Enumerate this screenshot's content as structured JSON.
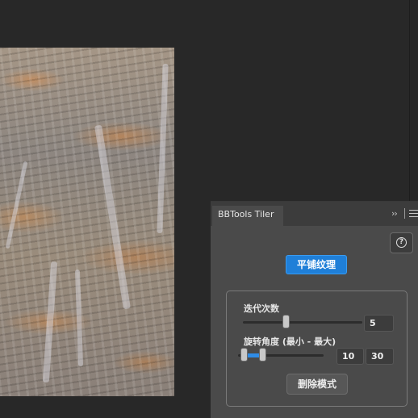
{
  "panel": {
    "title": "BBTools Tiler",
    "collapse_glyph": "››",
    "tile_button_label": "平铺纹理",
    "iterations_label": "迭代次数",
    "iterations_value": "5",
    "iterations_slider_fraction": 0.36,
    "rotation_label": "旋转角度 (最小 - 最大)",
    "rotation_min_value": "10",
    "rotation_max_value": "30",
    "rotation_range_fraction": [
      0.07,
      0.28
    ],
    "delete_button_label": "删除模式"
  },
  "icons": {
    "help": "help-circle-icon",
    "menu": "hamburger-menu-icon",
    "collapse": "double-chevron-right-icon"
  },
  "colors": {
    "accent": "#1f7fd8",
    "panel_bg": "#4a4a4a",
    "canvas_bg": "#282828"
  }
}
